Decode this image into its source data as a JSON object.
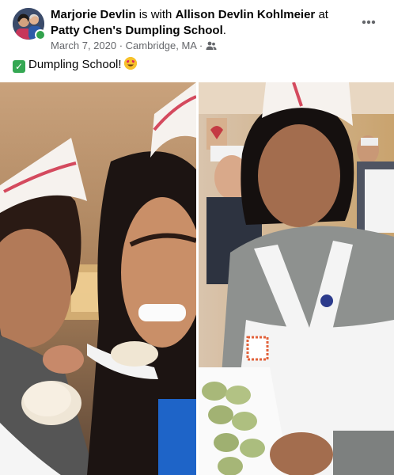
{
  "post": {
    "author": "Marjorie Devlin",
    "with_text": " is with ",
    "tagged": "Allison Devlin Kohlmeier",
    "at_text": " at ",
    "place": "Patty Chen's Dumpling School",
    "place_suffix": ".",
    "date": "March 7, 2020",
    "separator": " · ",
    "location": "Cambridge, MA",
    "separator2": " · ",
    "audience_icon": "friends-icon",
    "more_icon": "more-horizontal-icon",
    "text": "Dumpling School!",
    "emoji_prefix": "check-mark-icon",
    "emoji_suffix": "heart-eyes-emoji"
  },
  "photos": [
    {
      "name": "photo-left"
    },
    {
      "name": "photo-right"
    }
  ]
}
